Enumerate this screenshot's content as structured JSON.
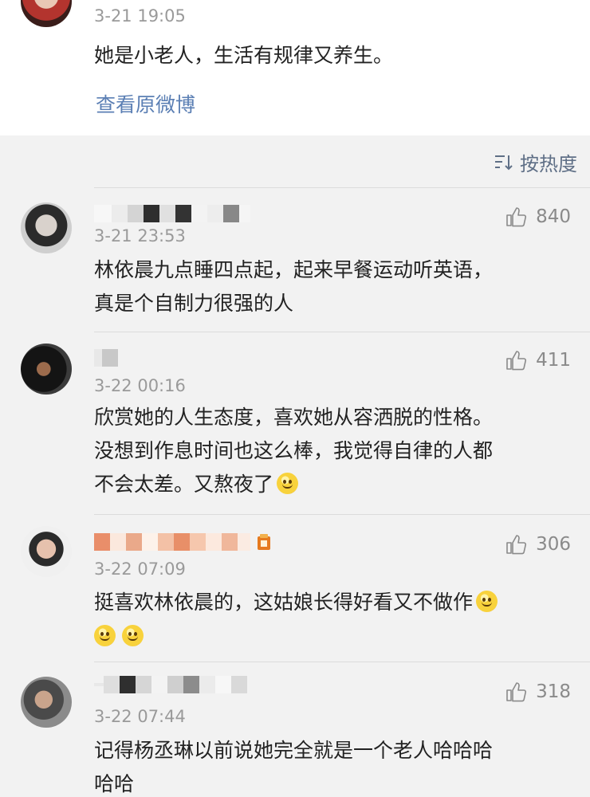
{
  "post": {
    "time": "3-21 19:05",
    "text": "她是小老人，生活有规律又养生。",
    "view_original": "查看原微博"
  },
  "sort": {
    "icon": "sort-icon",
    "label": "按热度"
  },
  "comments": [
    {
      "time": "3-21 23:53",
      "likes": "840",
      "text_lines": [
        "林依晨九点睡四点起，起来早餐运动听英语，",
        "真是个自制力很强的人"
      ]
    },
    {
      "time": "3-22 00:16",
      "likes": "411",
      "text_lines": [
        "欣赏她的人生态度，喜欢她从容洒脱的性格。",
        "没想到作息时间也这么棒，我觉得自律的人都",
        "不会太差。又熬夜了"
      ]
    },
    {
      "time": "3-22 07:09",
      "likes": "306",
      "text_lines": [
        "挺喜欢林依晨的，这姑娘长得好看又不做作"
      ]
    },
    {
      "time": "3-22 07:44",
      "likes": "318",
      "text_lines": [
        "记得杨丞琳以前说她完全就是一个老人哈哈哈",
        "哈哈"
      ]
    }
  ],
  "colors": {
    "link": "#5b7fb4",
    "muted": "#9a9a9a",
    "background": "#f2f2f2"
  }
}
